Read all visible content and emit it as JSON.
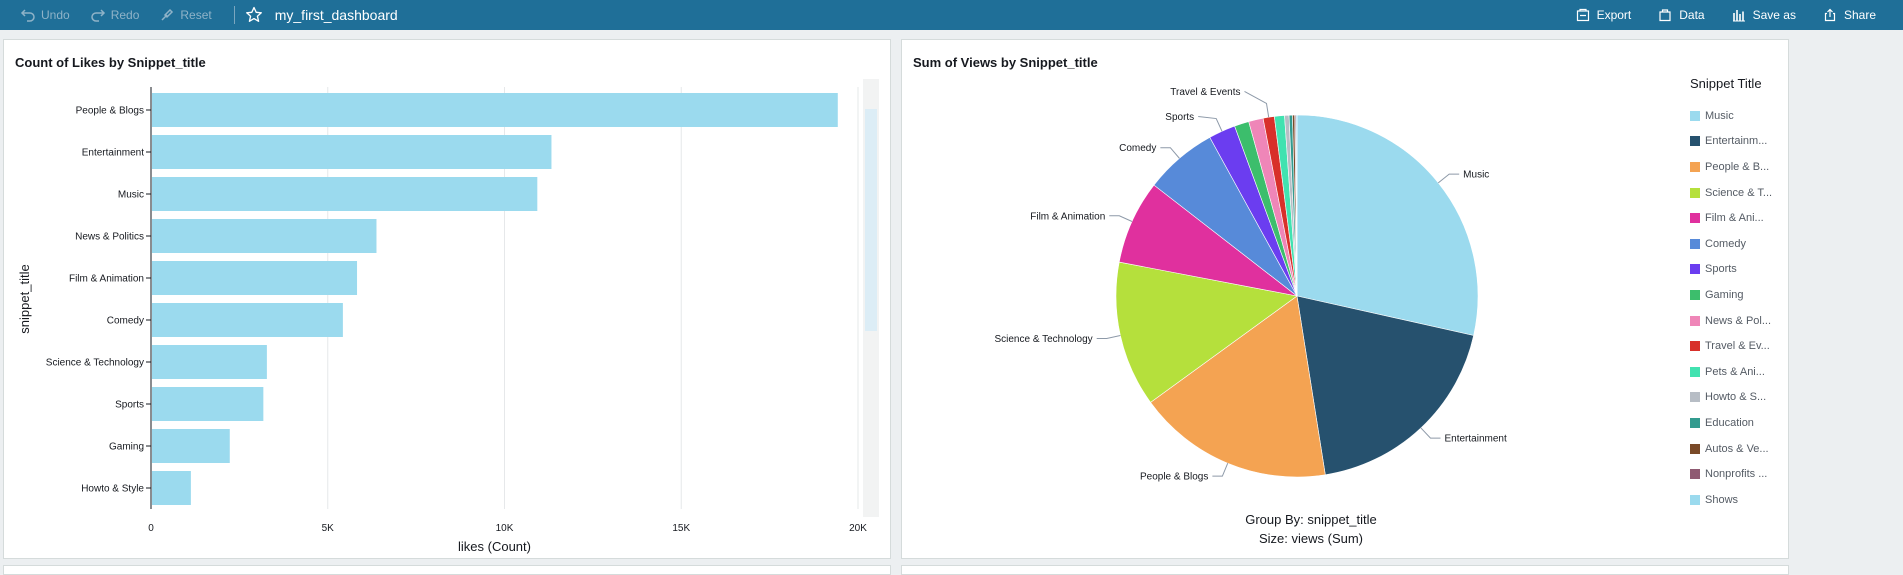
{
  "toolbar": {
    "undo_label": "Undo",
    "redo_label": "Redo",
    "reset_label": "Reset",
    "dashboard_title": "my_first_dashboard",
    "export_label": "Export",
    "data_label": "Data",
    "save_as_label": "Save as",
    "share_label": "Share"
  },
  "bar_panel": {
    "title": "Count of Likes by Snippet_title"
  },
  "pie_panel": {
    "title": "Sum of Views by Snippet_title",
    "legend_title": "Snippet Title",
    "group_by": "Group By: snippet_title",
    "size_by": "Size: views (Sum)",
    "legend": [
      {
        "label": "Music",
        "color": "#9bdaee"
      },
      {
        "label": "Entertainm...",
        "color": "#26516e"
      },
      {
        "label": "People & B...",
        "color": "#f4a352"
      },
      {
        "label": "Science & T...",
        "color": "#b5e03c"
      },
      {
        "label": "Film & Ani...",
        "color": "#e0309e"
      },
      {
        "label": "Comedy",
        "color": "#578ad9"
      },
      {
        "label": "Sports",
        "color": "#6b3df0"
      },
      {
        "label": "Gaming",
        "color": "#3cbe6c"
      },
      {
        "label": "News & Pol...",
        "color": "#ef86b8"
      },
      {
        "label": "Travel & Ev...",
        "color": "#d8302a"
      },
      {
        "label": "Pets & Ani...",
        "color": "#41e2b0"
      },
      {
        "label": "Howto & S...",
        "color": "#b7bdc5"
      },
      {
        "label": "Education",
        "color": "#339b8f"
      },
      {
        "label": "Autos & Ve...",
        "color": "#7a4a28"
      },
      {
        "label": "Nonprofits ...",
        "color": "#8f5a72"
      },
      {
        "label": "Shows",
        "color": "#9bdaee"
      }
    ]
  },
  "chart_data": [
    {
      "type": "bar",
      "orientation": "horizontal",
      "title": "Count of Likes by Snippet_title",
      "xlabel": "likes (Count)",
      "ylabel": "snippet_title",
      "categories": [
        "People & Blogs",
        "Entertainment",
        "Music",
        "News & Politics",
        "Film & Animation",
        "Comedy",
        "Science & Technology",
        "Sports",
        "Gaming",
        "Howto & Style"
      ],
      "values": [
        19400,
        11300,
        10900,
        6350,
        5800,
        5400,
        3250,
        3150,
        2200,
        1100
      ],
      "xlim": [
        0,
        20000
      ],
      "xticks": [
        "0",
        "5K",
        "10K",
        "15K",
        "20K"
      ],
      "bar_color": "#9bdaee",
      "grid": true
    },
    {
      "type": "pie",
      "title": "Sum of Views by Snippet_title",
      "labels": [
        "Music",
        "Entertainment",
        "People & Blogs",
        "Science & Technology",
        "Film & Animation",
        "Comedy",
        "Sports",
        "Gaming",
        "News & Politics",
        "Travel & Events",
        "Pets & Animals",
        "Howto & Style",
        "Education",
        "Autos & Vehicles",
        "Nonprofits & Activism",
        "Shows"
      ],
      "values": [
        28.5,
        19.0,
        17.5,
        13.0,
        7.5,
        6.5,
        2.4,
        1.3,
        1.3,
        1.0,
        0.9,
        0.4,
        0.3,
        0.2,
        0.1,
        0.1
      ],
      "shown_labels": [
        "Music",
        "Entertainment",
        "People & Blogs",
        "Science & Technology",
        "Film & Animation",
        "Comedy",
        "Sports",
        "Travel & Events"
      ],
      "colors": [
        "#9bdaee",
        "#26516e",
        "#f4a352",
        "#b5e03c",
        "#e0309e",
        "#578ad9",
        "#6b3df0",
        "#3cbe6c",
        "#ef86b8",
        "#d8302a",
        "#41e2b0",
        "#b7bdc5",
        "#339b8f",
        "#7a4a28",
        "#8f5a72",
        "#9bdaee"
      ]
    }
  ]
}
